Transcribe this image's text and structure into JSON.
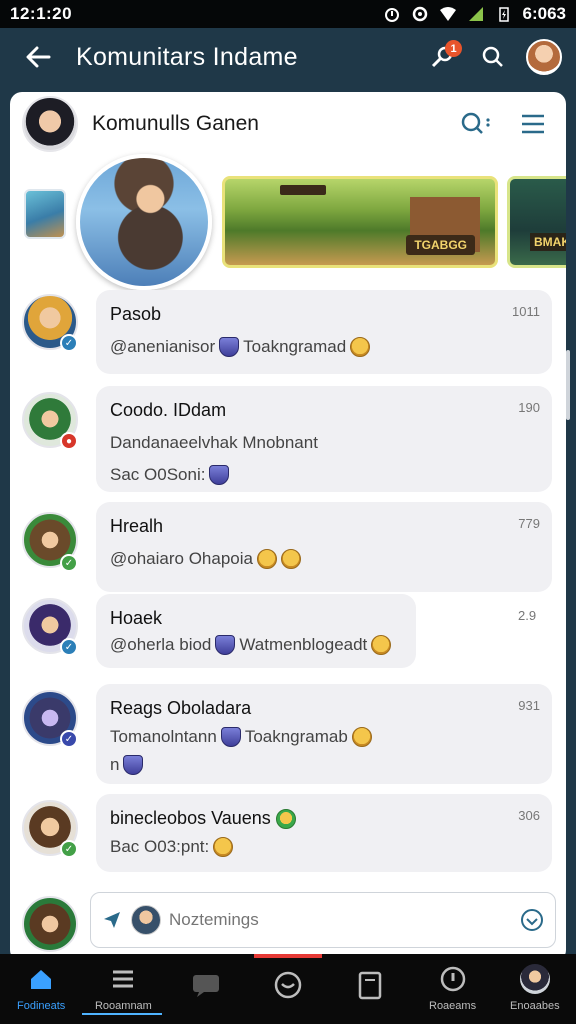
{
  "status_bar": {
    "time": "12:1:20",
    "right_time": "6:063"
  },
  "app_bar": {
    "title": "Komunitars Indame",
    "notification_count": "1"
  },
  "group": {
    "name": "Komunulls Ganen"
  },
  "stories": {
    "banner_tag": "TGABGG",
    "banner2_tag": "BMAK"
  },
  "messages": [
    {
      "name": "Pasob",
      "line1": "@anenianisor",
      "line1b": "Toakngramad",
      "time": "1011",
      "status_color": "#2c7fb8"
    },
    {
      "name": "Coodo. IDdam",
      "line1": "Dandanaeelvhak Mnobnant",
      "line2": "Sac O0Soni:",
      "time": "190",
      "status_color": "#d7372a"
    },
    {
      "name": "Hrealh",
      "line1": "@ohaiaro Ohapoia",
      "time": "779",
      "status_color": "#43a047"
    },
    {
      "name": "Hoaek",
      "line1": "@oherla biod",
      "line1b": "Watmenblogeadt",
      "time": "2.9",
      "status_color": "#2c7fb8"
    },
    {
      "name": "Reags Oboladara",
      "line1": "Tomanolntann",
      "line1b": "Toakngramab",
      "line2": "n",
      "time": "931",
      "status_color": "#3949ab"
    },
    {
      "name": "binecleobos Vauens",
      "line1": "Bac O03:pnt:",
      "time": "306",
      "status_color": "#43a047"
    }
  ],
  "composer": {
    "placeholder": "Noztemings"
  },
  "bottom_nav": [
    {
      "label": "Fodineats",
      "icon": "home-icon",
      "active": true
    },
    {
      "label": "Rooamnam",
      "icon": "menu-icon",
      "active": false
    },
    {
      "label": "",
      "icon": "chat-icon",
      "active": false
    },
    {
      "label": "",
      "icon": "emoji-icon",
      "active": false
    },
    {
      "label": "",
      "icon": "document-icon",
      "active": false
    },
    {
      "label": "Roaeams",
      "icon": "info-icon",
      "active": false
    },
    {
      "label": "Enoaabes",
      "icon": "profile-icon",
      "active": false
    }
  ],
  "colors": {
    "appbar": "#1f3848",
    "accent": "#3aa0ff",
    "indicator": "#e53935"
  }
}
